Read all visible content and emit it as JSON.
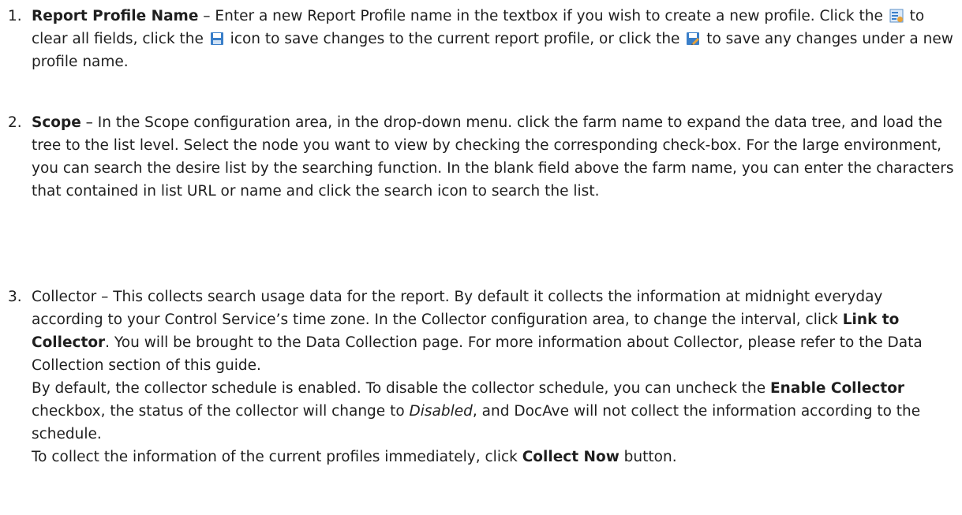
{
  "steps": [
    {
      "number": "1.",
      "heading": "Report Profile Name",
      "parts": [
        " – Enter a new Report Profile name in the textbox if you wish to create a new profile. Click the ",
        " to clear all fields, click the ",
        " icon to save changes to the current report profile, or click the ",
        " to save any changes under a new profile name."
      ],
      "icons": [
        "new-profile-icon",
        "save-icon",
        "save-as-icon"
      ]
    },
    {
      "number": "2.",
      "heading": "Scope",
      "text": " – In the Scope configuration area, in the drop-down menu. click the farm name to expand the data tree, and load the tree to the list level. Select the node you want to view by checking the corresponding check-box. For the large environment, you can search the desire list by the searching function. In the blank field above the farm name, you can enter the characters that contained in list URL or name and click the search icon to search the list."
    },
    {
      "number": "3.",
      "lead": "Collector – This collects search usage data for the report. By default it collects the information at midnight everyday according to your Control Service’s time zone. In the Collector configuration area, to change the interval, click ",
      "link_label": "Link to Collector",
      "tail": ". You will be brought to the Data Collection page. For more information about Collector, please refer to the Data Collection section of this guide.",
      "p2_a": "By default, the collector schedule is enabled. To disable the collector schedule, you can uncheck the ",
      "enable_label": "Enable Collector",
      "p2_b": " checkbox, the status of the collector will change to ",
      "disabled_word": "Disabled",
      "p2_c": ", and DocAve will not collect the information according to the schedule.",
      "p3_a": "To collect the information of the current profiles immediately, click ",
      "collect_label": "Collect Now",
      "p3_b": " button."
    }
  ],
  "colors": {
    "icon_blue": "#3a7fc9",
    "icon_orange": "#e8a23a",
    "text": "#1f1f1f"
  }
}
